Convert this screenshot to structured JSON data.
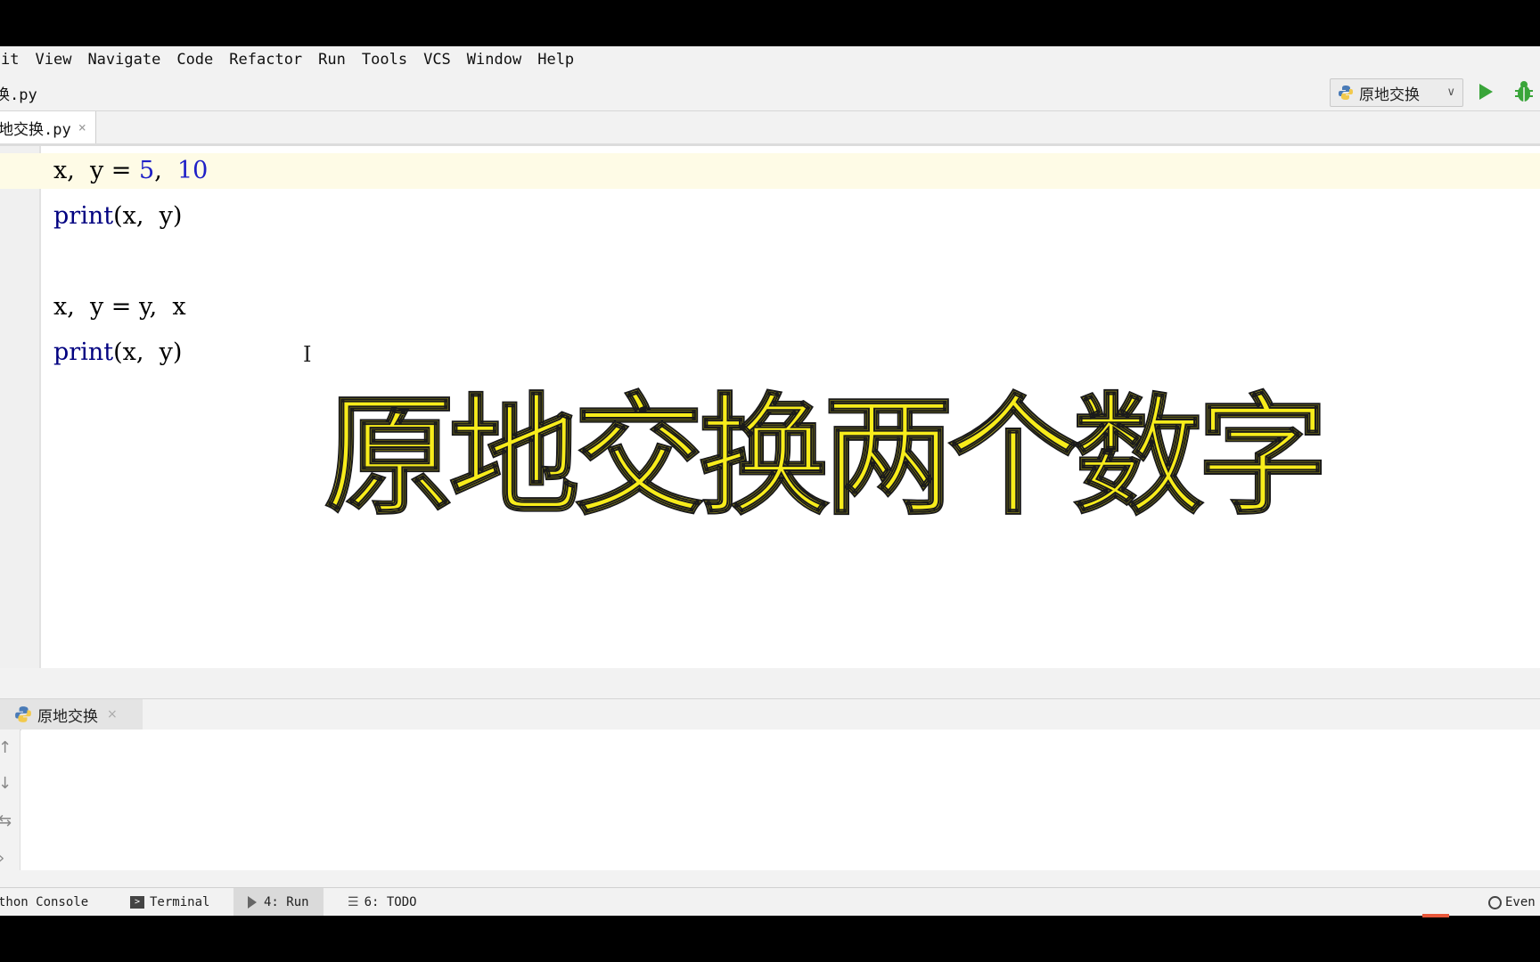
{
  "menubar": {
    "items": [
      "it",
      "View",
      "Navigate",
      "Code",
      "Refactor",
      "Run",
      "Tools",
      "VCS",
      "Window",
      "Help"
    ]
  },
  "navbar": {
    "breadcrumb": "换.py",
    "run_config": "原地交换"
  },
  "editor_tab": {
    "label": "地交换.py",
    "close": "×"
  },
  "code": {
    "lines": [
      [
        {
          "t": "x,  y = ",
          "c": "plain"
        },
        {
          "t": "5",
          "c": "num"
        },
        {
          "t": ",  ",
          "c": "plain"
        },
        {
          "t": "10",
          "c": "num"
        }
      ],
      [
        {
          "t": "print",
          "c": "fn"
        },
        {
          "t": "(x,  y)",
          "c": "plain"
        }
      ],
      [],
      [
        {
          "t": "x,  y = y,  x",
          "c": "plain"
        }
      ],
      [
        {
          "t": "print",
          "c": "fn"
        },
        {
          "t": "(x,  y)",
          "c": "plain"
        }
      ]
    ],
    "cursor_glyph": "I"
  },
  "overlay_title": "原地交换两个数字",
  "run_panel": {
    "tab_label": "原地交换",
    "close": "×",
    "side_icons": [
      "↑",
      "↓",
      "⇆",
      "›"
    ]
  },
  "statusbar": {
    "python_console": "thon Console",
    "terminal": "Terminal",
    "run": "4: Run",
    "todo": "6: TODO",
    "event_log": "Even"
  },
  "colors": {
    "overlay_fill": "#f7ec1b",
    "number_literal": "#1f20c7",
    "builtin_fn": "#000080",
    "current_line": "#fefbe6",
    "run_button": "#3aa53a"
  }
}
